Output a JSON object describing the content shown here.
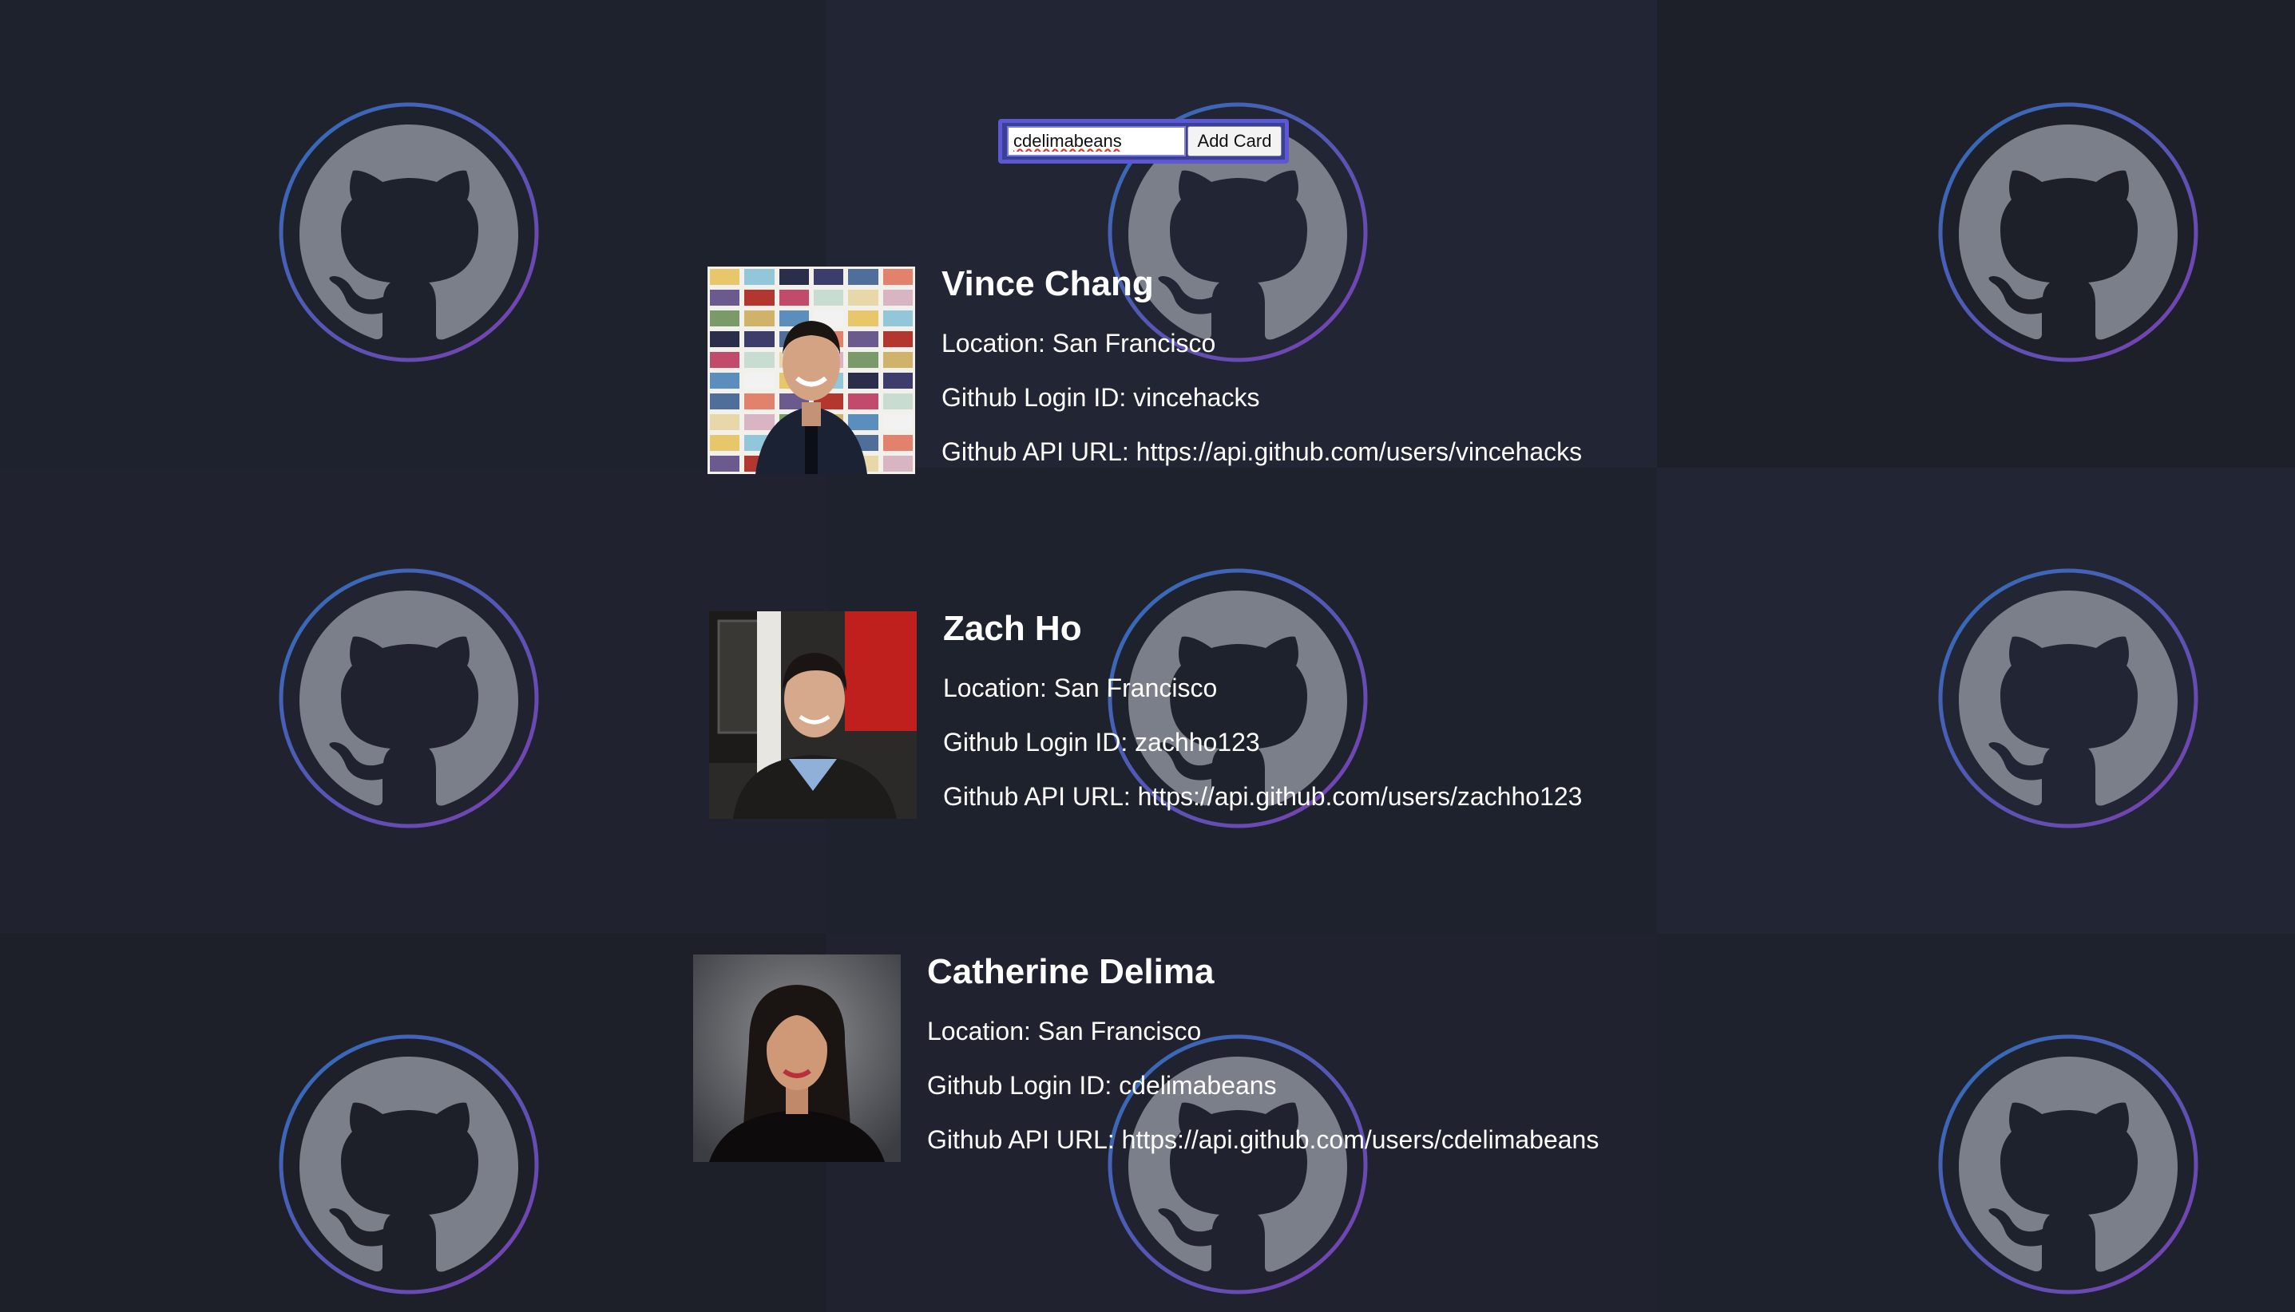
{
  "search": {
    "value": "cdelimabeans",
    "button_label": "Add Card"
  },
  "cards": [
    {
      "name": "Vince Chang",
      "location": "Location: San Francisco",
      "login": "Github Login ID: vincehacks",
      "api_url": "Github API URL: https://api.github.com/users/vincehacks"
    },
    {
      "name": "Zach Ho",
      "location": "Location: San Francisco",
      "login": "Github Login ID: zachho123",
      "api_url": "Github API URL: https://api.github.com/users/zachho123"
    },
    {
      "name": "Catherine Delima",
      "location": "Location: San Francisco",
      "login": "Github Login ID: cdelimabeans",
      "api_url": "Github API URL: https://api.github.com/users/cdelimabeans"
    }
  ],
  "colors": {
    "background": "#1c1f29",
    "badge_ring_start": "#2f6fb8",
    "badge_ring_end": "#7b3fb0",
    "badge_fill": "#7b7f8a",
    "form_border": "#5d57d1"
  },
  "icons": {
    "background_logo": "github-octocat-icon"
  }
}
